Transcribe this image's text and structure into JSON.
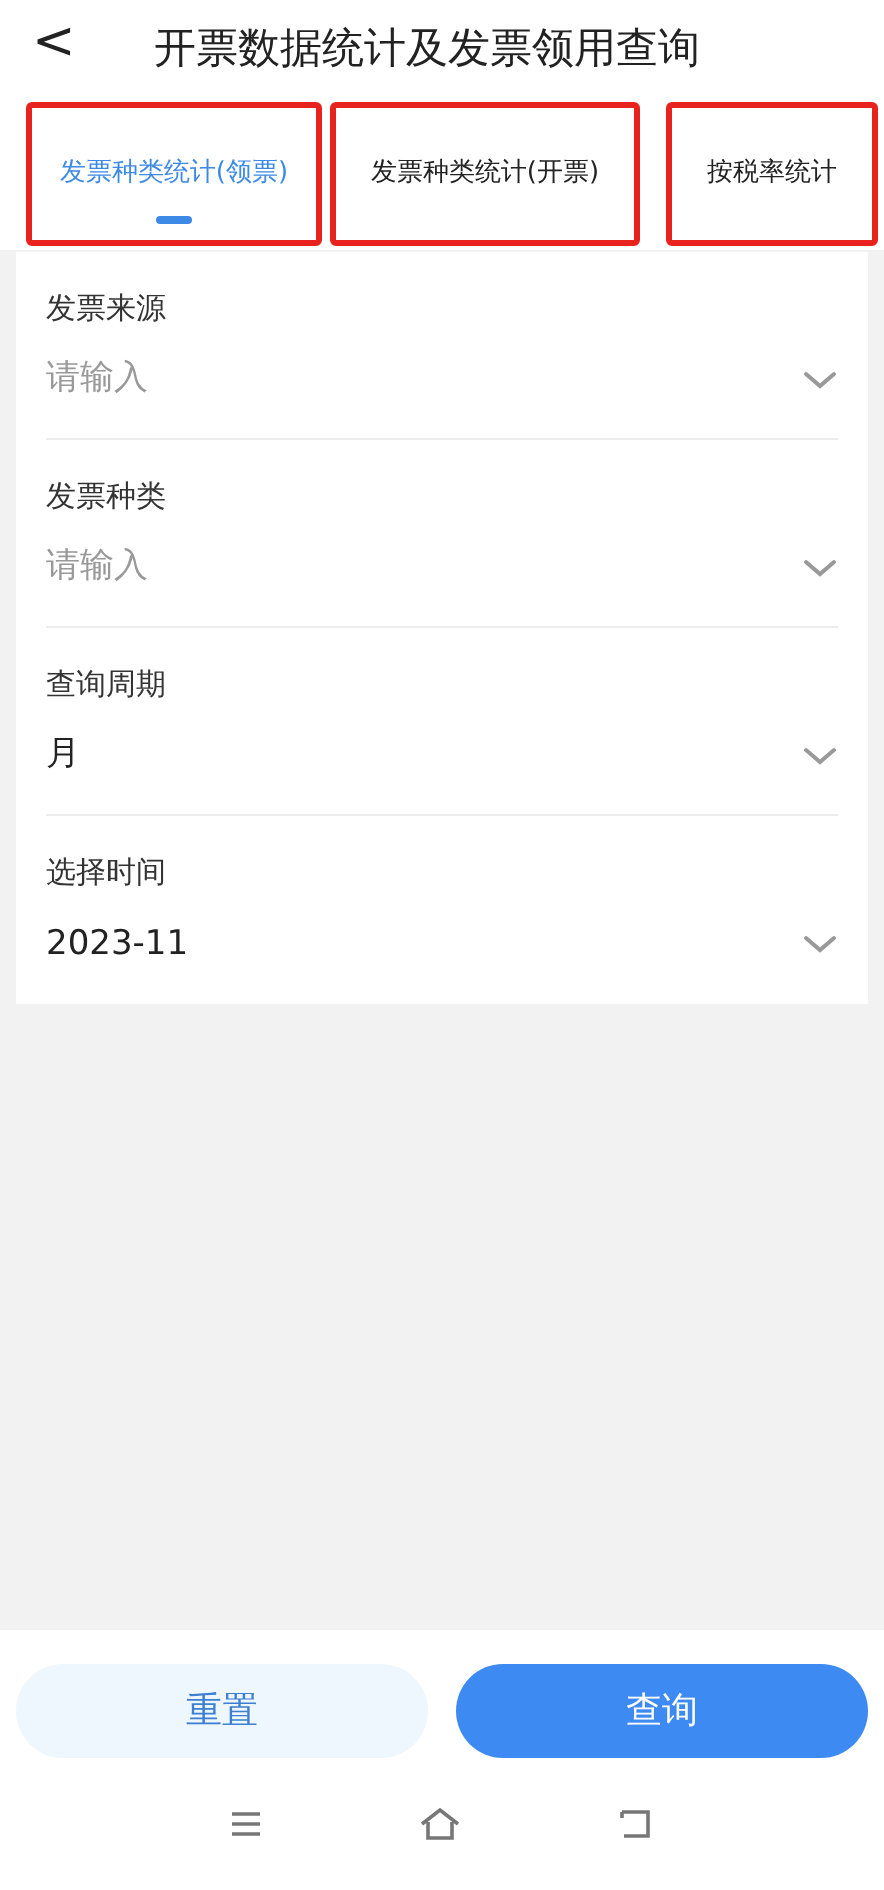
{
  "header": {
    "back": "<",
    "title": "开票数据统计及发票领用查询"
  },
  "tabs": [
    {
      "label": "发票种类统计(领票)",
      "selected": true
    },
    {
      "label": "发票种类统计(开票)",
      "selected": false
    },
    {
      "label": "按税率统计",
      "selected": false
    }
  ],
  "form": [
    {
      "label": "发票来源",
      "placeholder": "请输入"
    },
    {
      "label": "发票种类",
      "placeholder": "请输入"
    },
    {
      "label": "查询周期",
      "value": "月"
    },
    {
      "label": "选择时间",
      "value": "2023-11"
    }
  ],
  "buttons": [
    {
      "label": "重置",
      "kind": "secondary"
    },
    {
      "label": "查询",
      "kind": "primary"
    }
  ]
}
